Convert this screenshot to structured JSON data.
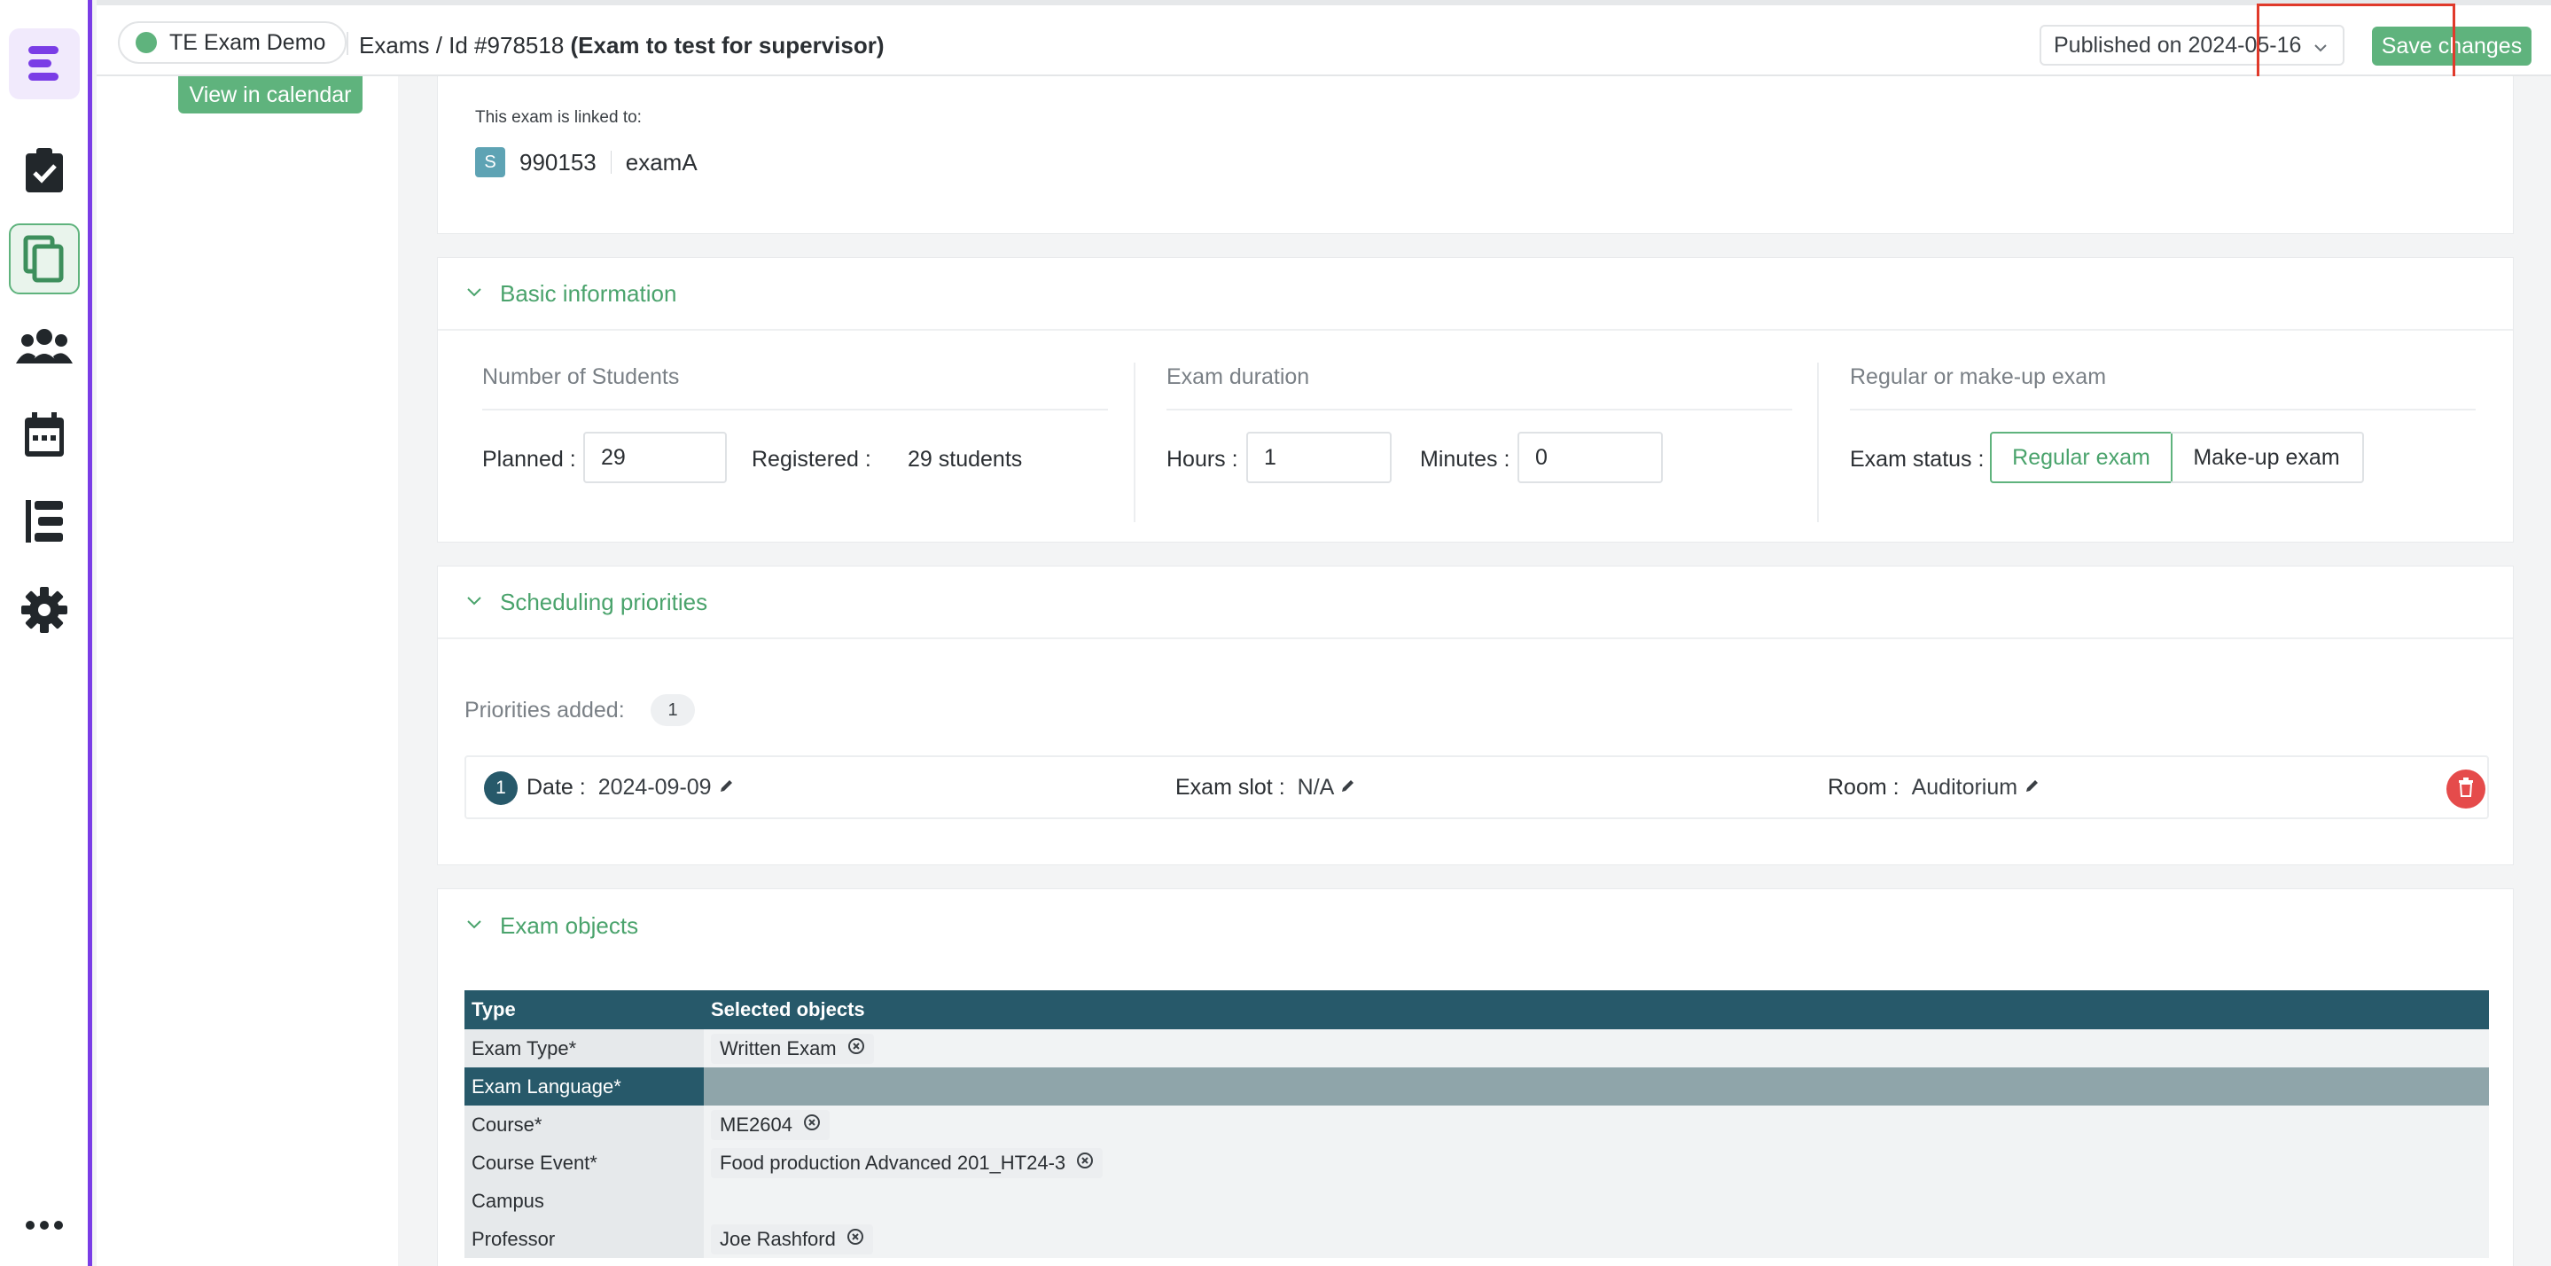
{
  "topbar": {
    "tenant": "TE Exam Demo",
    "breadcrumb_section": "Exams",
    "breadcrumb_id": "/ Id #978518",
    "breadcrumb_name": "(Exam to test for supervisor)",
    "published": "Published on 2024-05-16",
    "save_label": "Save changes"
  },
  "left": {
    "view_calendar": "View in calendar"
  },
  "linked": {
    "label": "This exam is linked to:",
    "badge": "S",
    "code": "990153",
    "name": "examA"
  },
  "basic": {
    "title": "Basic information",
    "students": {
      "title": "Number of Students",
      "planned_label": "Planned :",
      "planned_value": "29",
      "registered_label": "Registered :",
      "registered_value": "29 students"
    },
    "duration": {
      "title": "Exam duration",
      "hours_label": "Hours :",
      "hours_value": "1",
      "minutes_label": "Minutes :",
      "minutes_value": "0"
    },
    "regular": {
      "title": "Regular or make-up exam",
      "status_label": "Exam status :",
      "regular_option": "Regular exam",
      "makeup_option": "Make-up exam"
    }
  },
  "scheduling": {
    "title": "Scheduling priorities",
    "added_label": "Priorities added:",
    "added_count": "1",
    "row": {
      "num": "1",
      "date_label": "Date :",
      "date_value": "2024-09-09",
      "slot_label": "Exam slot :",
      "slot_value": "N/A",
      "room_label": "Room :",
      "room_value": "Auditorium"
    }
  },
  "objects": {
    "title": "Exam objects",
    "headers": [
      "Type",
      "Selected objects"
    ],
    "rows": [
      {
        "type": "Exam Type*",
        "value": "Written Exam"
      },
      {
        "type": "Exam Language*",
        "value": ""
      },
      {
        "type": "Course*",
        "value": "ME2604"
      },
      {
        "type": "Course Event*",
        "value": "Food production Advanced 201_HT24-3"
      },
      {
        "type": "Campus",
        "value": ""
      },
      {
        "type": "Professor",
        "value": "Joe Rashford"
      }
    ]
  },
  "colors": {
    "accent": "#5fb37d",
    "rail_border": "#7a3de6",
    "header_dark": "#27596a",
    "danger": "#e54b4b",
    "annotation": "#e03a2b"
  }
}
